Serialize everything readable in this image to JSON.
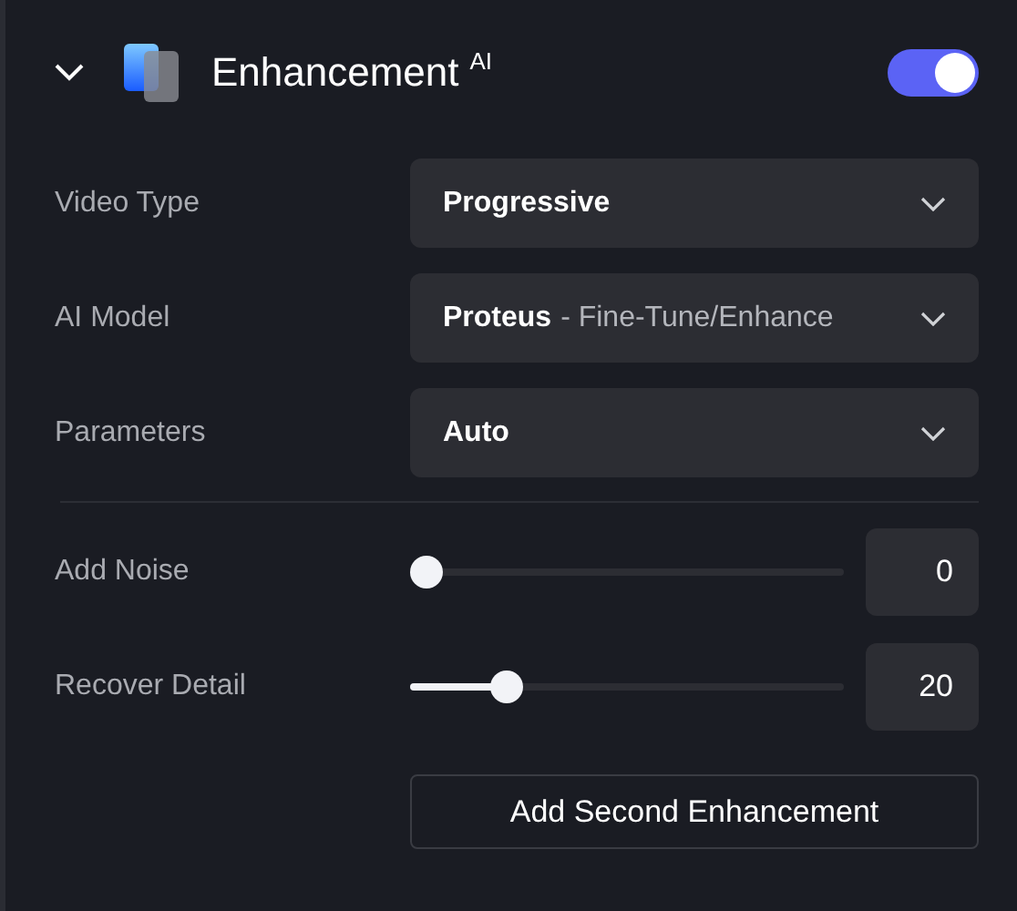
{
  "section": {
    "title": "Enhancement",
    "badge": "AI",
    "expanded": true,
    "enabled": true
  },
  "dropdowns": [
    {
      "label": "Video Type",
      "value": "Progressive"
    },
    {
      "label": "AI Model",
      "value": "Proteus",
      "detail": "- Fine-Tune/Enhance"
    },
    {
      "label": "Parameters",
      "value": "Auto"
    }
  ],
  "sliders": [
    {
      "label": "Add Noise",
      "level": 0,
      "reading": "0"
    },
    {
      "label": "Recover Detail",
      "level": 0.2,
      "reading": "20"
    }
  ],
  "button": "Add Second Enhancement"
}
